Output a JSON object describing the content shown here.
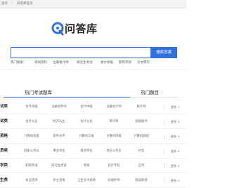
{
  "topbar": {
    "home": "首页",
    "sep": "|",
    "site": "问答库首页"
  },
  "logo": {
    "brand": "问答库"
  },
  "search": {
    "placeholder": "",
    "button_label": "搜索答案"
  },
  "hot_search": {
    "label": "热门搜索：",
    "terms": [
      "考研资料",
      "注册会计师",
      "研究生考试",
      "会计初级",
      "职称英语",
      "论文撰写"
    ]
  },
  "columns": {
    "left_title": "热门考试题库",
    "right_title": "热门题目"
  },
  "more_label": "更多 >",
  "rows": [
    {
      "category": "试类",
      "cells": [
        "会计初级",
        "注册税务师",
        "会计中级",
        "注册会计师",
        "统计师"
      ]
    },
    {
      "category": "试类",
      "cells": [
        "会计从业",
        "经济从业",
        "会计从业",
        "审计师",
        "国家秘书"
      ]
    },
    {
      "category": "资格",
      "cells": [
        "计算机初级",
        "软件水平",
        "计算机三级",
        "计算机四级",
        "计算机基础"
      ]
    },
    {
      "category": "员类",
      "cells": [
        "国家公务员",
        "事业单位",
        "政府单位",
        "地方公务员",
        "村官"
      ]
    },
    {
      "category": "学类",
      "cells": [
        "职称英语",
        "研究生考试",
        "考研",
        "会计专科",
        "自考"
      ]
    },
    {
      "category": "生类",
      "cells": [
        "执业药师",
        "护士资格",
        "卫生技术资格",
        "初级护师",
        "临床助理"
      ]
    }
  ]
}
